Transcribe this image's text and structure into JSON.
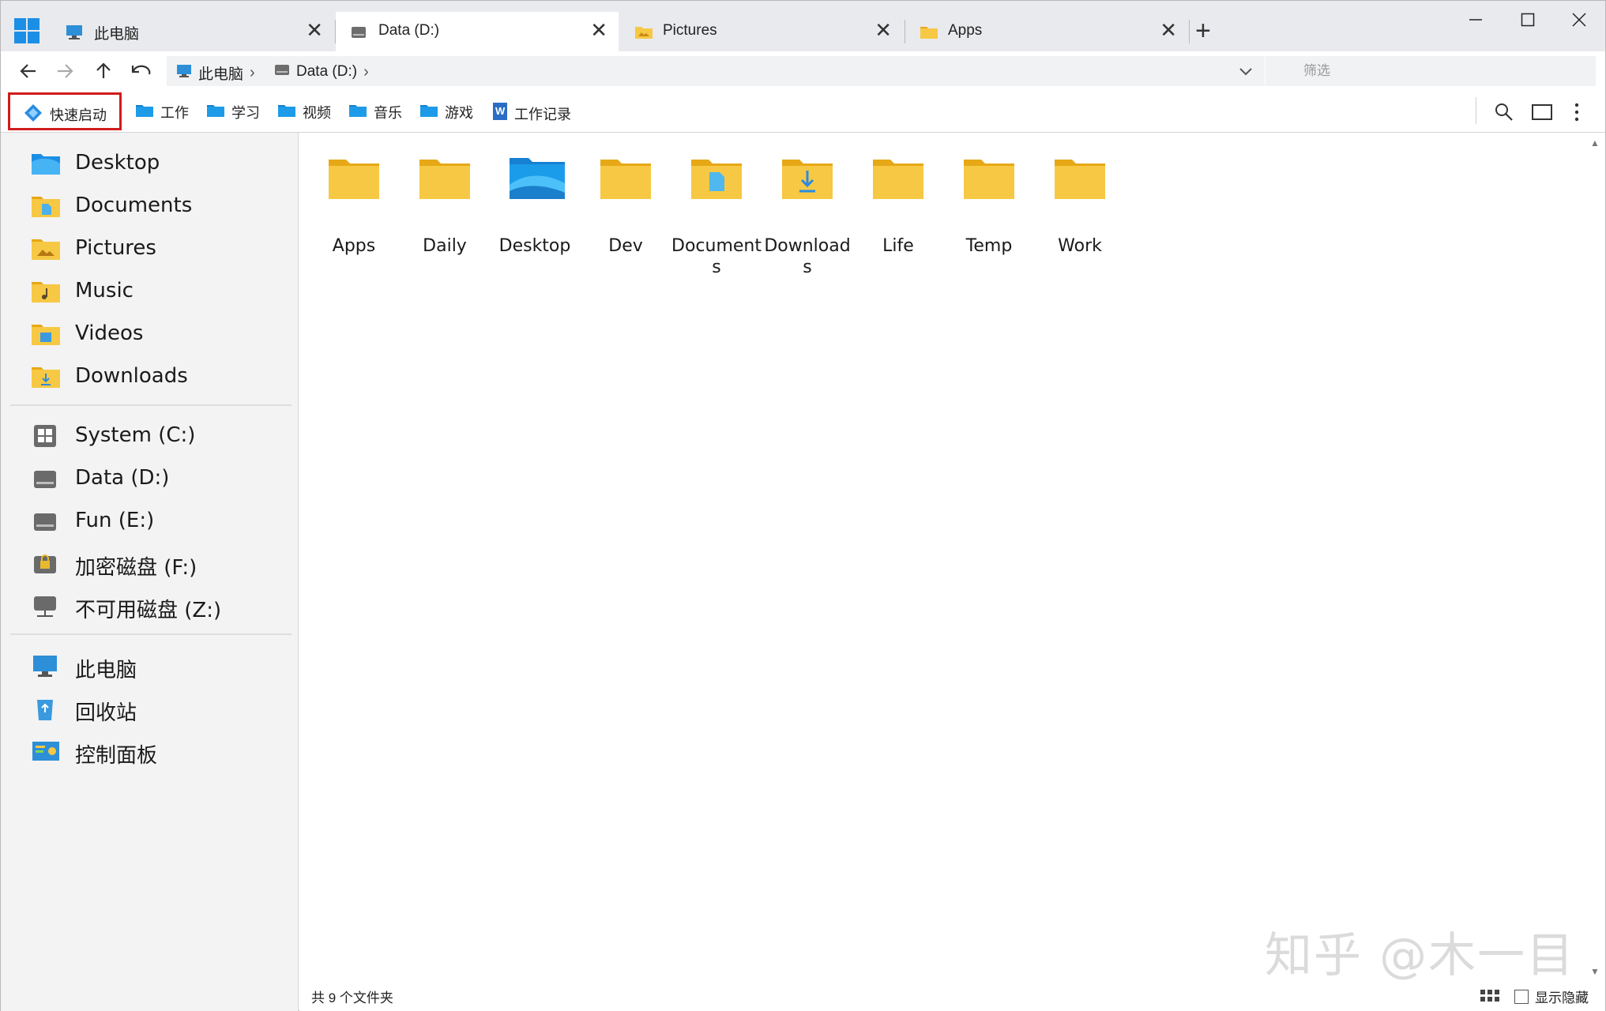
{
  "tabs": [
    {
      "title": "此电脑",
      "icon": "computer-icon",
      "active": false
    },
    {
      "title": "Data (D:)",
      "icon": "drive-icon",
      "active": true
    },
    {
      "title": "Pictures",
      "icon": "pictures-folder-icon",
      "active": false
    },
    {
      "title": "Apps",
      "icon": "folder-icon",
      "active": false
    }
  ],
  "new_tab_label": "+",
  "window_controls": {
    "minimize": "—",
    "maximize": "☐",
    "close": "✕"
  },
  "nav": {
    "back": "←",
    "forward": "→",
    "up": "↑",
    "undo": "↶"
  },
  "breadcrumb": [
    {
      "label": "此电脑",
      "icon": "computer-icon"
    },
    {
      "label": "Data (D:)",
      "icon": "drive-icon"
    }
  ],
  "filter": {
    "placeholder": "筛选",
    "value": ""
  },
  "quick_launch": {
    "label": "快速启动",
    "icon": "quick-launch-icon"
  },
  "bookmarks": [
    {
      "label": "工作",
      "icon": "folder-icon"
    },
    {
      "label": "学习",
      "icon": "folder-icon"
    },
    {
      "label": "视频",
      "icon": "folder-icon"
    },
    {
      "label": "音乐",
      "icon": "folder-icon"
    },
    {
      "label": "游戏",
      "icon": "folder-icon"
    },
    {
      "label": "工作记录",
      "icon": "word-doc-icon"
    }
  ],
  "toolbar_icons": [
    "search-icon",
    "view-pane-icon",
    "more-options-icon"
  ],
  "sidebar": {
    "user_folders": [
      {
        "label": "Desktop",
        "icon": "desktop-folder-icon"
      },
      {
        "label": "Documents",
        "icon": "documents-folder-icon"
      },
      {
        "label": "Pictures",
        "icon": "pictures-folder-icon"
      },
      {
        "label": "Music",
        "icon": "music-folder-icon"
      },
      {
        "label": "Videos",
        "icon": "videos-folder-icon"
      },
      {
        "label": "Downloads",
        "icon": "downloads-folder-icon"
      }
    ],
    "drives": [
      {
        "label": "System (C:)",
        "icon": "system-drive-icon"
      },
      {
        "label": "Data (D:)",
        "icon": "drive-icon"
      },
      {
        "label": "Fun (E:)",
        "icon": "drive-icon"
      },
      {
        "label": "加密磁盘 (F:)",
        "icon": "locked-drive-icon"
      },
      {
        "label": "不可用磁盘 (Z:)",
        "icon": "network-drive-icon"
      }
    ],
    "system": [
      {
        "label": "此电脑",
        "icon": "computer-icon"
      },
      {
        "label": "回收站",
        "icon": "recycle-bin-icon"
      },
      {
        "label": "控制面板",
        "icon": "control-panel-icon"
      }
    ]
  },
  "folders": [
    {
      "name": "Apps",
      "icon": "folder-icon"
    },
    {
      "name": "Daily",
      "icon": "folder-icon"
    },
    {
      "name": "Desktop",
      "icon": "desktop-folder-icon"
    },
    {
      "name": "Dev",
      "icon": "folder-icon"
    },
    {
      "name": "Documents",
      "icon": "documents-folder-icon"
    },
    {
      "name": "Downloads",
      "icon": "downloads-folder-icon"
    },
    {
      "name": "Life",
      "icon": "folder-icon"
    },
    {
      "name": "Temp",
      "icon": "folder-icon"
    },
    {
      "name": "Work",
      "icon": "folder-icon"
    }
  ],
  "status": {
    "summary": "共 9 个文件夹",
    "show_hidden_label": "显示隐藏",
    "show_hidden_checked": false
  },
  "watermark": "知乎 @木一目",
  "colors": {
    "accent": "#1b8fe6",
    "folder": "#f7c843",
    "folder_tab": "#e6a817",
    "highlight_border": "#d11c1c"
  }
}
